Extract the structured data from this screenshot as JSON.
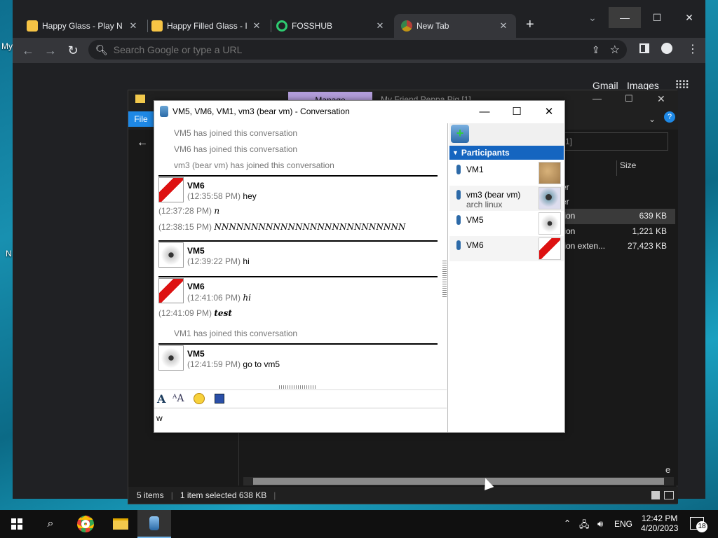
{
  "desktop": {
    "icon_label_top": "My",
    "icon_label_bottom": "N"
  },
  "chrome": {
    "tabs": [
      {
        "title": "Happy Glass - Play N",
        "active": false
      },
      {
        "title": "Happy Filled Glass - I",
        "active": false
      },
      {
        "title": "FOSSHUB",
        "active": false
      },
      {
        "title": "New Tab",
        "active": true
      }
    ],
    "new_tab": "+",
    "omnibox_placeholder": "Search Google or type a URL",
    "ntp_links": [
      "Gmail",
      "Images"
    ]
  },
  "explorer": {
    "menu_file": "File",
    "tab_manage": "Manage",
    "window_title": "My Friend Peppa Pig [1]",
    "search_placeholder": "1]",
    "col_size": "Size",
    "rows": [
      {
        "type": "er",
        "size": ""
      },
      {
        "type": "er",
        "size": ""
      },
      {
        "type": "tion",
        "size": "639 KB"
      },
      {
        "type": "tion",
        "size": "1,221 KB"
      },
      {
        "type": "tion exten...",
        "size": "27,423 KB"
      }
    ],
    "status": {
      "items": "5 items",
      "selected": "1 item selected  638 KB"
    },
    "partial_button": "e"
  },
  "conversation": {
    "title": "VM5, VM6, VM1, vm3 (bear vm) - Conversation",
    "system_msgs": [
      "VM5 has joined this conversation",
      "VM6 has joined this conversation",
      "vm3 (bear vm) has joined this conversation"
    ],
    "blocks": [
      {
        "nick": "VM6",
        "lines": [
          {
            "time": "(12:35:58 PM)",
            "text": "hey"
          },
          {
            "time": "(12:37:28 PM)",
            "text": "n"
          },
          {
            "time": "(12:38:15 PM)",
            "text": "NNNNNNNNNNNNNNNNNNNNNNNNNN"
          }
        ]
      },
      {
        "nick": "VM5",
        "lines": [
          {
            "time": "(12:39:22 PM)",
            "text": "hi"
          }
        ]
      },
      {
        "nick": "VM6",
        "lines": [
          {
            "time": "(12:41:06 PM)",
            "text": "hi"
          },
          {
            "time": "(12:41:09 PM)",
            "text": "test"
          }
        ]
      },
      {
        "nick": "VM5",
        "lines": [
          {
            "time": "(12:41:59 PM)",
            "text": "go to vm5"
          }
        ]
      }
    ],
    "system_vm1": "VM1 has joined this conversation",
    "compose_value": "w",
    "participants_header": "Participants",
    "participants": [
      {
        "name": "VM1",
        "sub": ""
      },
      {
        "name": "vm3 (bear vm)",
        "sub": "arch linux"
      },
      {
        "name": "VM5",
        "sub": ""
      },
      {
        "name": "VM6",
        "sub": ""
      }
    ]
  },
  "taskbar": {
    "lang": "ENG",
    "time": "12:42 PM",
    "date": "4/20/2023",
    "notif_count": "18"
  }
}
